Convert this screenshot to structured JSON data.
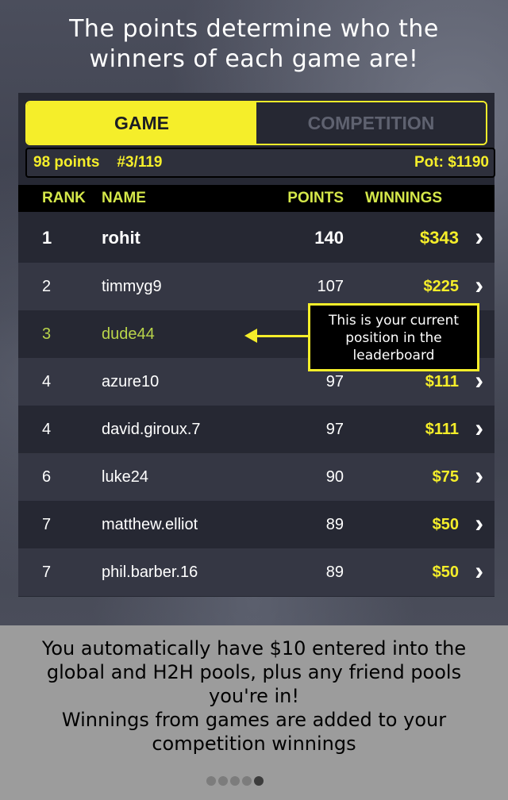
{
  "headline": [
    "The points determine who the",
    "winners of each game are!"
  ],
  "tabs": [
    {
      "label": "GAME",
      "active": true
    },
    {
      "label": "COMPETITION",
      "active": false
    }
  ],
  "status": {
    "points": "98 points",
    "rank": "#3/119",
    "pot": "Pot: $1190"
  },
  "table": {
    "headers": {
      "rank": "RANK",
      "name": "NAME",
      "points": "POINTS",
      "winnings": "WINNINGS"
    },
    "rows": [
      {
        "rank": "1",
        "name": "rohit",
        "points": "140",
        "winnings": "$343"
      },
      {
        "rank": "2",
        "name": "timmyg9",
        "points": "107",
        "winnings": "$225"
      },
      {
        "rank": "3",
        "name": "dude44",
        "points": "",
        "winnings": ""
      },
      {
        "rank": "4",
        "name": "azure10",
        "points": "97",
        "winnings": "$111"
      },
      {
        "rank": "4",
        "name": "david.giroux.7",
        "points": "97",
        "winnings": "$111"
      },
      {
        "rank": "6",
        "name": "luke24",
        "points": "90",
        "winnings": "$75"
      },
      {
        "rank": "7",
        "name": "matthew.elliot",
        "points": "89",
        "winnings": "$50"
      },
      {
        "rank": "7",
        "name": "phil.barber.16",
        "points": "89",
        "winnings": "$50"
      }
    ]
  },
  "callout": [
    "This is your current",
    "position in the",
    "leaderboard"
  ],
  "footer": [
    "You automatically have $10 entered into the",
    "global and H2H pools, plus any friend pools",
    "you're in!",
    "Winnings from games are added to your",
    "competition winnings"
  ],
  "pager": {
    "count": 5,
    "active_index": 4
  },
  "colors": {
    "accent": "#f5ee2a",
    "highlight": "#b9d44a",
    "header_text": "#d5e84a",
    "panel": "#262833"
  }
}
